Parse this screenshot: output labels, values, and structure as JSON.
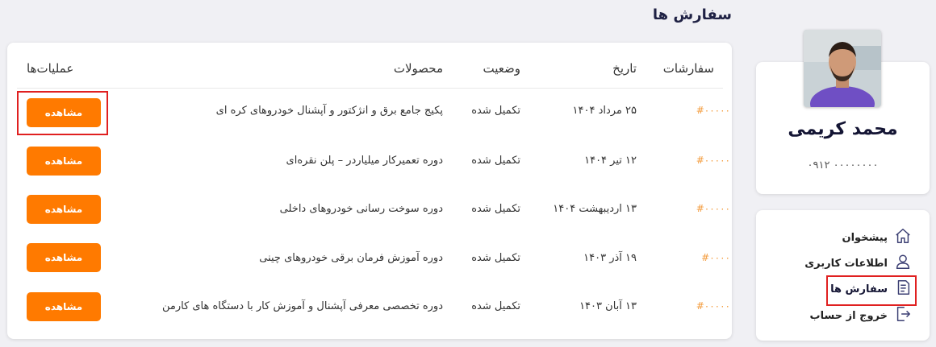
{
  "page": {
    "title": "سفارش ها"
  },
  "profile": {
    "name": "محمد کریمی",
    "phone": "۰۹۱۲ ۰۰۰۰۰۰۰۰"
  },
  "menu": {
    "items": [
      {
        "label": "پیشخوان",
        "icon": "home-icon"
      },
      {
        "label": "اطلاعات کاربری",
        "icon": "user-icon"
      },
      {
        "label": "سفارش ها",
        "icon": "orders-document-icon",
        "active": true
      },
      {
        "label": "خروج از حساب",
        "icon": "logout-icon"
      }
    ]
  },
  "table": {
    "headers": {
      "orders": "سفارشات",
      "date": "تاریخ",
      "status": "وضعیت",
      "products": "محصولات",
      "actions": "عملیات‌ها"
    },
    "rows": [
      {
        "id": "#۰۰۰۰۰",
        "date": "۲۵ مرداد ۱۴۰۴",
        "status": "تکمیل شده",
        "product": "پکیج جامع برق و انژکتور و آپشنال خودروهای کره ای",
        "action": "مشاهده"
      },
      {
        "id": "#۰۰۰۰۰",
        "date": "۱۲ تیر ۱۴۰۴",
        "status": "تکمیل شده",
        "product": "دوره تعمیرکار میلیاردر – پلن نقره‌ای",
        "action": "مشاهده"
      },
      {
        "id": "#۰۰۰۰۰",
        "date": "۱۳ اردیبهشت ۱۴۰۴",
        "status": "تکمیل شده",
        "product": "دوره سوخت رسانی خودروهای داخلی",
        "action": "مشاهده"
      },
      {
        "id": "#۰۰۰۰",
        "date": "۱۹ آذر ۱۴۰۳",
        "status": "تکمیل شده",
        "product": "دوره آموزش فرمان برقی خودروهای چینی",
        "action": "مشاهده"
      },
      {
        "id": "#۰۰۰۰۰",
        "date": "۱۳ آبان ۱۴۰۳",
        "status": "تکمیل شده",
        "product": "دوره تخصصی معرفی آپشنال و آموزش کار با دستگاه های کارمن",
        "action": "مشاهده"
      }
    ]
  },
  "colors": {
    "accent": "#ff7a00",
    "order_id": "#f39a3a",
    "highlight": "#e02020"
  }
}
